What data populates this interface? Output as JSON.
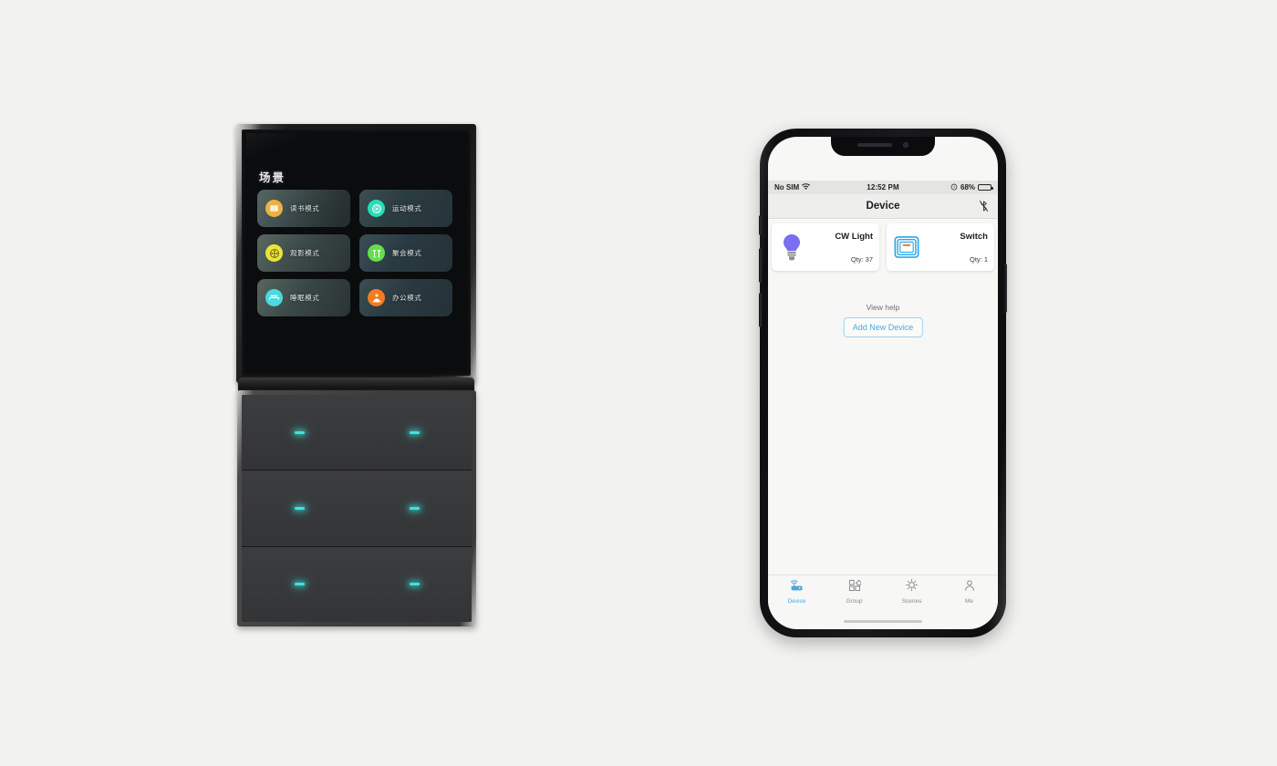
{
  "page": {
    "background_color": "#f2f2f0",
    "description": "Product shot: wall-mounted smart scene panel next to an iPhone running a smart-home app"
  },
  "panel": {
    "title": "场景",
    "scenes": [
      {
        "label": "读书模式",
        "icon": "book-icon",
        "icon_color": "#f0b040",
        "tile_variant": "t-a"
      },
      {
        "label": "运动模式",
        "icon": "sports-ball-icon",
        "icon_color": "#23e0b8",
        "tile_variant": "t-b"
      },
      {
        "label": "观影模式",
        "icon": "film-reel-icon",
        "icon_color": "#ebe33c",
        "tile_variant": "t-c"
      },
      {
        "label": "聚会模式",
        "icon": "cocktail-glasses-icon",
        "icon_color": "#64df4a",
        "tile_variant": "t-d"
      },
      {
        "label": "睡眠模式",
        "icon": "bed-icon",
        "icon_color": "#4bd8e0",
        "tile_variant": "t-e"
      },
      {
        "label": "办公模式",
        "icon": "person-desk-icon",
        "icon_color": "#f07d22",
        "tile_variant": "t-f"
      }
    ],
    "switch_module": {
      "rows": 3,
      "buttons_per_row": 2,
      "led_color": "#39e6e0"
    }
  },
  "phone": {
    "status_bar": {
      "carrier": "No SIM",
      "wifi_icon": "wifi-icon",
      "time": "12:52 PM",
      "lock_icon": "rotation-lock-icon",
      "battery_percent": "68%",
      "battery_level": 68
    },
    "nav_bar": {
      "title": "Device",
      "right_icon": "bluetooth-off-icon"
    },
    "devices": [
      {
        "name": "CW Light",
        "qty": "Qty: 37",
        "icon": "light-bulb-icon",
        "icon_color": "#7b6ef0"
      },
      {
        "name": "Switch",
        "qty": "Qty: 1",
        "icon": "wall-switch-icon",
        "icon_color": "#2aa8e8"
      }
    ],
    "view_help_label": "View help",
    "add_device_label": "Add New Device",
    "accent_color": "#4aa8e0",
    "tabs": [
      {
        "label": "Device",
        "icon": "router-hub-icon",
        "active": true
      },
      {
        "label": "Group",
        "icon": "grid-squares-icon",
        "active": false
      },
      {
        "label": "Scenes",
        "icon": "sun-icon",
        "active": false
      },
      {
        "label": "Me",
        "icon": "person-icon",
        "active": false
      }
    ]
  }
}
